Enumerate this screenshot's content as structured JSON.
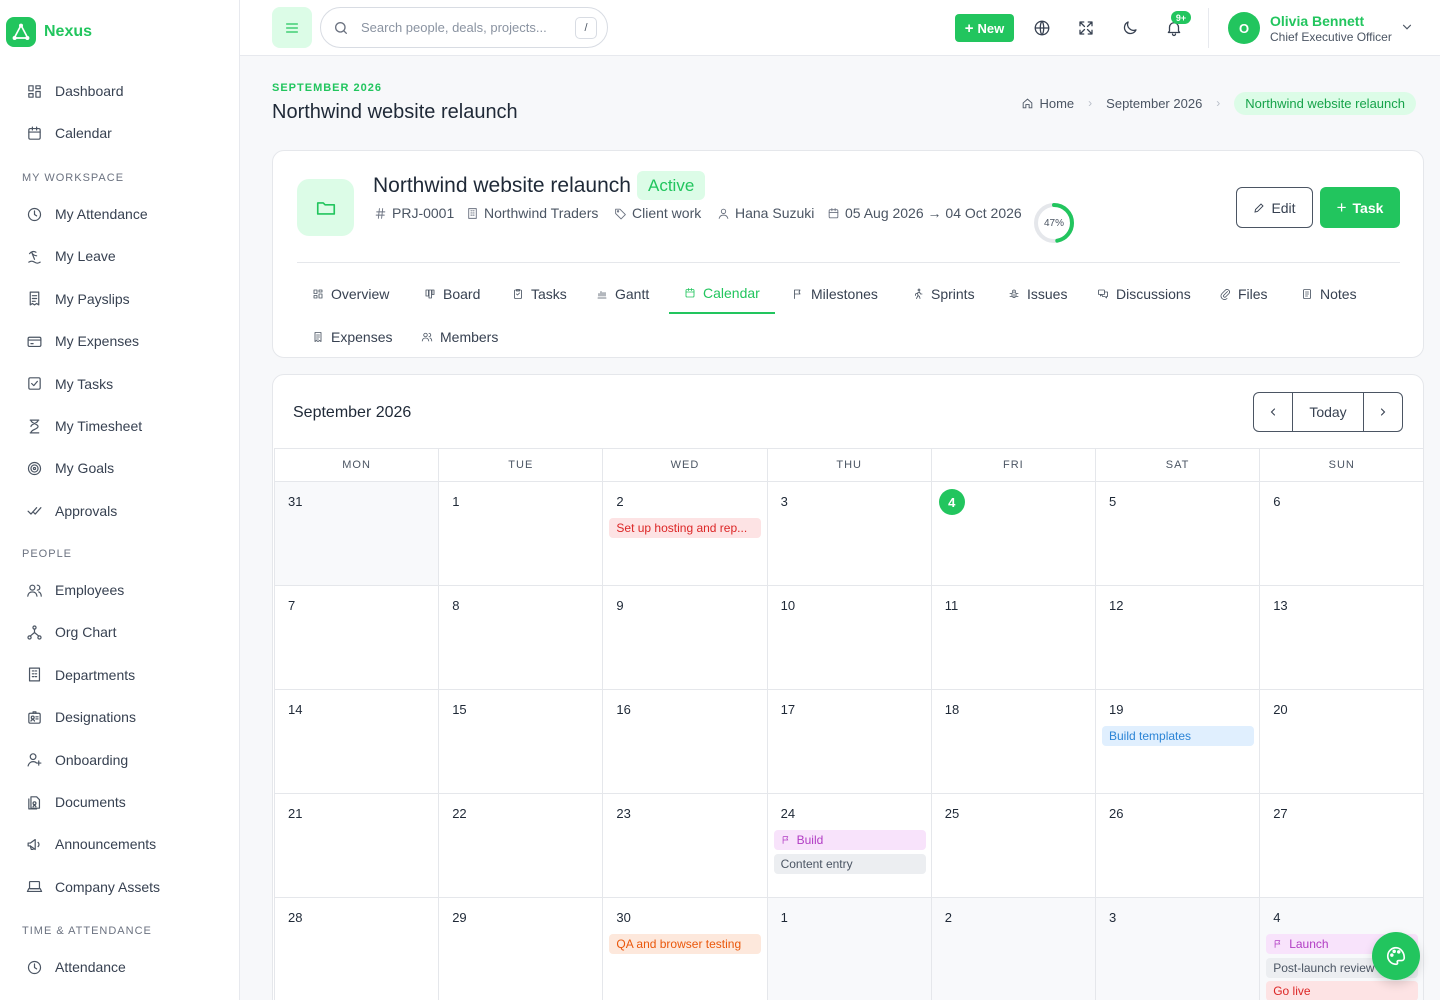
{
  "app": {
    "name": "Nexus",
    "brand_color": "#22c55e"
  },
  "sidebar": {
    "top_items": [
      {
        "label": "Dashboard",
        "icon": "dashboard-icon"
      },
      {
        "label": "Calendar",
        "icon": "calendar-icon"
      }
    ],
    "sections": [
      {
        "title": "MY WORKSPACE",
        "items": [
          {
            "label": "My Attendance",
            "icon": "clock-icon"
          },
          {
            "label": "My Leave",
            "icon": "beach-icon"
          },
          {
            "label": "My Payslips",
            "icon": "receipt-icon"
          },
          {
            "label": "My Expenses",
            "icon": "card-icon"
          },
          {
            "label": "My Tasks",
            "icon": "checkbox-icon"
          },
          {
            "label": "My Timesheet",
            "icon": "hourglass-icon"
          },
          {
            "label": "My Goals",
            "icon": "target-icon"
          },
          {
            "label": "Approvals",
            "icon": "double-check-icon"
          }
        ]
      },
      {
        "title": "PEOPLE",
        "items": [
          {
            "label": "Employees",
            "icon": "users-icon"
          },
          {
            "label": "Org Chart",
            "icon": "org-chart-icon"
          },
          {
            "label": "Departments",
            "icon": "building-icon"
          },
          {
            "label": "Designations",
            "icon": "id-badge-icon"
          },
          {
            "label": "Onboarding",
            "icon": "user-plus-icon"
          },
          {
            "label": "Documents",
            "icon": "documents-icon"
          },
          {
            "label": "Announcements",
            "icon": "megaphone-icon"
          },
          {
            "label": "Company Assets",
            "icon": "laptop-icon"
          }
        ]
      },
      {
        "title": "TIME & ATTENDANCE",
        "items": [
          {
            "label": "Attendance",
            "icon": "clock-icon"
          }
        ]
      }
    ]
  },
  "topbar": {
    "search_placeholder": "Search people, deals, projects...",
    "search_shortcut": "/",
    "new_label": "New",
    "notification_count": "9+",
    "user": {
      "initial": "O",
      "name": "Olivia Bennett",
      "role": "Chief Executive Officer"
    }
  },
  "page": {
    "eyebrow": "SEPTEMBER 2026",
    "title": "Northwind website relaunch",
    "breadcrumb": [
      "Home",
      "September 2026",
      "Northwind website relaunch"
    ]
  },
  "project": {
    "title": "Northwind website relaunch",
    "status": "Active",
    "code": "PRJ-0001",
    "client": "Northwind Traders",
    "category": "Client work",
    "owner": "Hana Suzuki",
    "dates": "05 Aug 2026 → 04 Oct 2026",
    "progress_pct": 47,
    "progress_label": "47%",
    "edit_label": "Edit",
    "task_label": "Task",
    "tabs": [
      {
        "label": "Overview",
        "icon": "overview-icon"
      },
      {
        "label": "Board",
        "icon": "board-icon"
      },
      {
        "label": "Tasks",
        "icon": "tasks-icon"
      },
      {
        "label": "Gantt",
        "icon": "gantt-icon"
      },
      {
        "label": "Calendar",
        "icon": "calendar-icon",
        "active": true
      },
      {
        "label": "Milestones",
        "icon": "flag-icon"
      },
      {
        "label": "Sprints",
        "icon": "runner-icon"
      },
      {
        "label": "Issues",
        "icon": "bug-icon"
      },
      {
        "label": "Discussions",
        "icon": "chat-icon"
      },
      {
        "label": "Files",
        "icon": "paperclip-icon"
      },
      {
        "label": "Notes",
        "icon": "note-icon"
      },
      {
        "label": "Expenses",
        "icon": "receipt-icon"
      },
      {
        "label": "Members",
        "icon": "users-icon"
      }
    ]
  },
  "calendar": {
    "title": "September 2026",
    "today_label": "Today",
    "prev_icon": "chevron-left-icon",
    "next_icon": "chevron-right-icon",
    "weekdays": [
      "MON",
      "TUE",
      "WED",
      "THU",
      "FRI",
      "SAT",
      "SUN"
    ],
    "weeks": [
      [
        {
          "n": "31",
          "m": true
        },
        {
          "n": "1"
        },
        {
          "n": "2",
          "events": [
            {
              "label": "Set up hosting and rep...",
              "kind": "red"
            }
          ]
        },
        {
          "n": "3"
        },
        {
          "n": "4",
          "today": true
        },
        {
          "n": "5"
        },
        {
          "n": "6"
        }
      ],
      [
        {
          "n": "7"
        },
        {
          "n": "8"
        },
        {
          "n": "9"
        },
        {
          "n": "10"
        },
        {
          "n": "11"
        },
        {
          "n": "12"
        },
        {
          "n": "13"
        }
      ],
      [
        {
          "n": "14"
        },
        {
          "n": "15"
        },
        {
          "n": "16"
        },
        {
          "n": "17"
        },
        {
          "n": "18"
        },
        {
          "n": "19",
          "events": [
            {
              "label": "Build templates",
              "kind": "blue"
            }
          ]
        },
        {
          "n": "20"
        }
      ],
      [
        {
          "n": "21"
        },
        {
          "n": "22"
        },
        {
          "n": "23"
        },
        {
          "n": "24",
          "events": [
            {
              "label": "Build",
              "kind": "purple",
              "flag": true
            },
            {
              "label": "Content entry",
              "kind": "gray"
            }
          ]
        },
        {
          "n": "25"
        },
        {
          "n": "26"
        },
        {
          "n": "27"
        }
      ],
      [
        {
          "n": "28"
        },
        {
          "n": "29"
        },
        {
          "n": "30",
          "events": [
            {
              "label": "QA and browser testing",
              "kind": "orange"
            }
          ]
        },
        {
          "n": "1",
          "m": true
        },
        {
          "n": "2",
          "m": true
        },
        {
          "n": "3",
          "m": true
        },
        {
          "n": "4",
          "m": true,
          "events": [
            {
              "label": "Launch",
              "kind": "purple",
              "flag": true
            },
            {
              "label": "Post-launch review",
              "kind": "gray"
            },
            {
              "label": "Go live",
              "kind": "red"
            }
          ]
        }
      ]
    ]
  }
}
